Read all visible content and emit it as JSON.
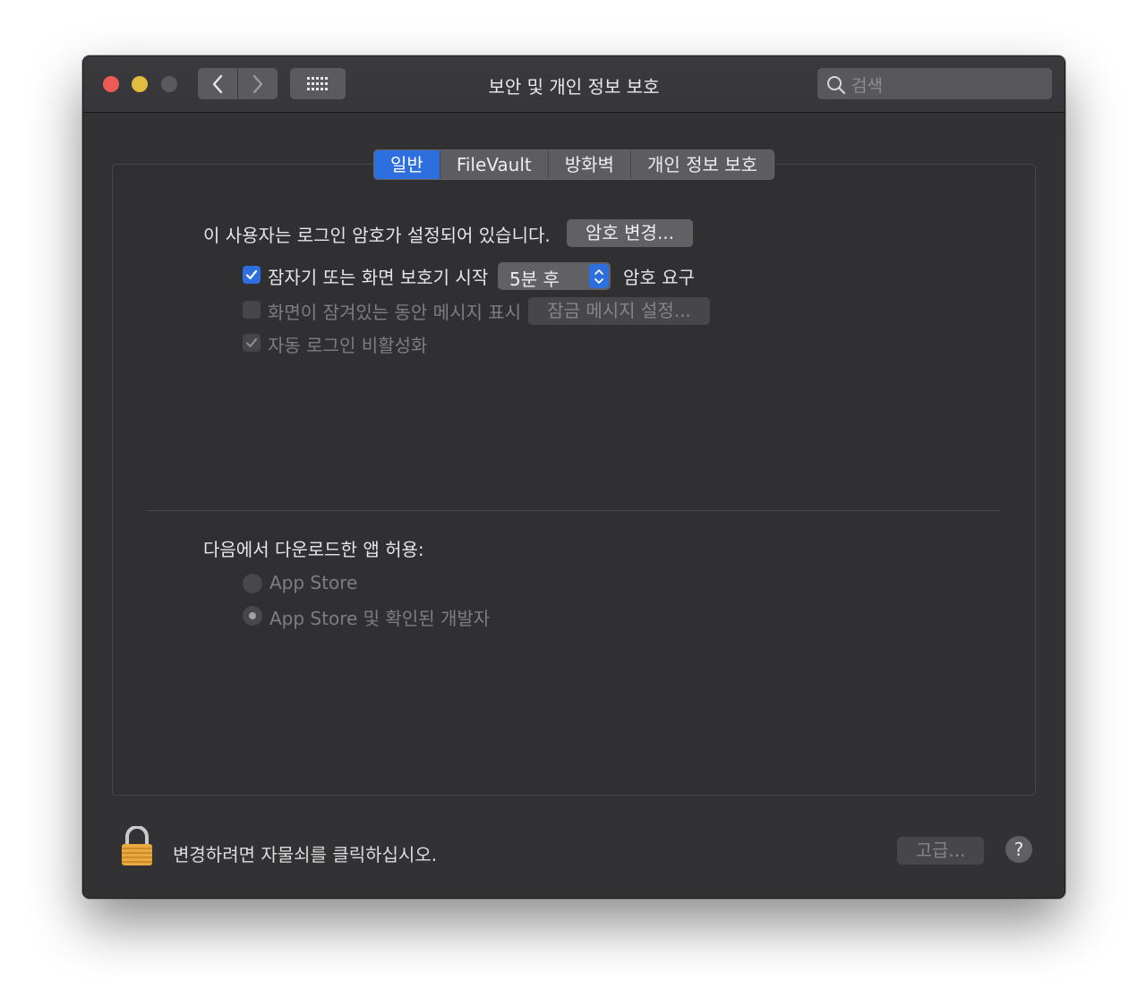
{
  "window": {
    "title": "보안 및 개인 정보 보호",
    "search_placeholder": "검색"
  },
  "tabs": [
    {
      "label": "일반",
      "active": true
    },
    {
      "label": "FileVault",
      "active": false
    },
    {
      "label": "방화벽",
      "active": false
    },
    {
      "label": "개인 정보 보호",
      "active": false
    }
  ],
  "general": {
    "password_status": "이 사용자는 로그인 암호가 설정되어 있습니다.",
    "change_password_button": "암호 변경...",
    "require_password_label": "잠자기 또는 화면 보호기 시작",
    "require_password_delay": "5분 후",
    "require_password_suffix": "암호 요구",
    "show_message_label": "화면이 잠겨있는 동안 메시지 표시",
    "set_lock_message_button": "잠금 메시지 설정...",
    "disable_auto_login_label": "자동 로그인 비활성화"
  },
  "downloads": {
    "heading": "다음에서 다운로드한 앱 허용:",
    "options": [
      "App Store",
      "App Store 및 확인된 개발자"
    ],
    "selected": "App Store 및 확인된 개발자"
  },
  "footer": {
    "lock_text": "변경하려면 자물쇠를 클릭하십시오.",
    "advanced_button": "고급...",
    "help_button": "?"
  },
  "colors": {
    "accent": "#2d6fdf",
    "window_bg": "#323234",
    "close": "#ed5b57",
    "minimize": "#e0bd3f"
  }
}
